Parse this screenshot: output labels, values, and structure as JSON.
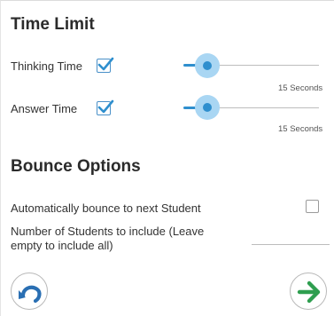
{
  "time_limit": {
    "title": "Time Limit",
    "thinking_time": {
      "label": "Thinking Time",
      "checked": true,
      "value_text": "15 Seconds",
      "slider_fraction": 0.1
    },
    "answer_time": {
      "label": "Answer Time",
      "checked": true,
      "value_text": "15 Seconds",
      "slider_fraction": 0.1
    }
  },
  "bounce_options": {
    "title": "Bounce Options",
    "auto_bounce": {
      "label": "Automatically bounce to next Student",
      "checked": false
    },
    "students_to_include": {
      "label_line1": "Number of Students to include (Leave",
      "label_line2": "empty to include all)",
      "value": ""
    }
  },
  "footer": {
    "back_icon": "undo-arrow-icon",
    "next_icon": "right-arrow-icon"
  },
  "colors": {
    "accent_blue": "#2f8fce",
    "slider_halo": "#a9d6f3",
    "checkmark_blue": "#2f8fce",
    "next_green": "#2e9e4f",
    "back_blue": "#2a6fb3"
  }
}
